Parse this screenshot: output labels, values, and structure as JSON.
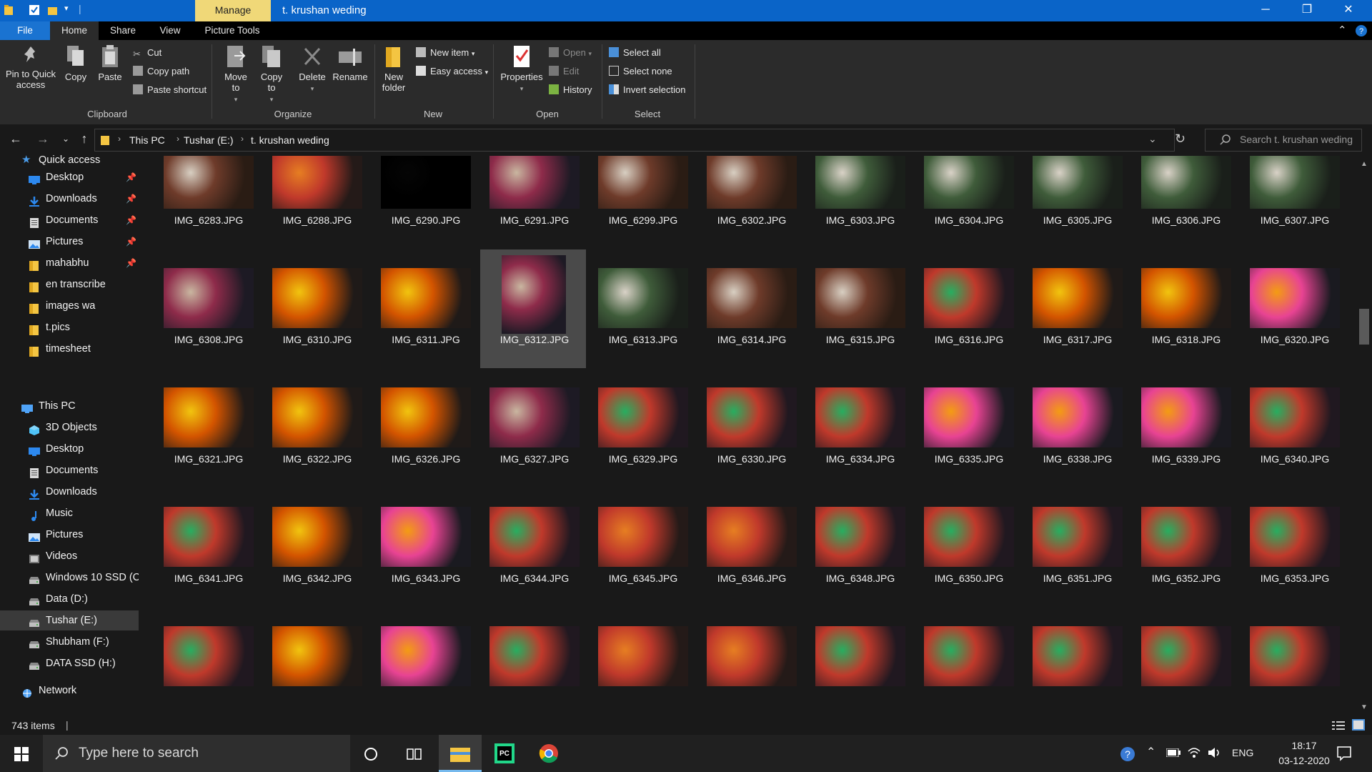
{
  "titlebar": {
    "context_tab": "Manage",
    "title": "t. krushan weding",
    "accent": "#0a64c8"
  },
  "ribbon_tabs": [
    "File",
    "Home",
    "Share",
    "View",
    "Picture Tools"
  ],
  "ribbon": {
    "clipboard": {
      "pin": "Pin to Quick access",
      "copy": "Copy",
      "paste": "Paste",
      "cut": "Cut",
      "copy_path": "Copy path",
      "paste_shortcut": "Paste shortcut",
      "group": "Clipboard"
    },
    "organize": {
      "move_to": "Move to",
      "copy_to": "Copy to",
      "delete": "Delete",
      "rename": "Rename",
      "group": "Organize"
    },
    "new": {
      "new_folder": "New folder",
      "new_item": "New item",
      "easy_access": "Easy access",
      "group": "New"
    },
    "open": {
      "properties": "Properties",
      "open": "Open",
      "edit": "Edit",
      "history": "History",
      "group": "Open"
    },
    "select": {
      "select_all": "Select all",
      "select_none": "Select none",
      "invert": "Invert selection",
      "group": "Select"
    }
  },
  "address": {
    "crumbs": [
      "This PC",
      "Tushar (E:)",
      "t. krushan weding"
    ],
    "search_placeholder": "Search t. krushan weding"
  },
  "sidebar": {
    "quick_access": "Quick access",
    "quick_items": [
      {
        "label": "Desktop",
        "icon": "desktop-icon",
        "pinned": true
      },
      {
        "label": "Downloads",
        "icon": "downloads-icon",
        "pinned": true
      },
      {
        "label": "Documents",
        "icon": "documents-icon",
        "pinned": true
      },
      {
        "label": "Pictures",
        "icon": "pictures-icon",
        "pinned": true
      },
      {
        "label": "mahabhu",
        "icon": "folder-icon",
        "pinned": true
      },
      {
        "label": "en transcribe",
        "icon": "folder-icon",
        "pinned": false
      },
      {
        "label": "images wa",
        "icon": "folder-icon",
        "pinned": false
      },
      {
        "label": "t.pics",
        "icon": "folder-icon",
        "pinned": false
      },
      {
        "label": "timesheet",
        "icon": "folder-icon",
        "pinned": false
      }
    ],
    "this_pc": "This PC",
    "pc_items": [
      {
        "label": "3D Objects",
        "icon": "3d-objects-icon"
      },
      {
        "label": "Desktop",
        "icon": "desktop-icon"
      },
      {
        "label": "Documents",
        "icon": "documents-icon"
      },
      {
        "label": "Downloads",
        "icon": "downloads-icon"
      },
      {
        "label": "Music",
        "icon": "music-icon"
      },
      {
        "label": "Pictures",
        "icon": "pictures-icon"
      },
      {
        "label": "Videos",
        "icon": "videos-icon"
      },
      {
        "label": "Windows 10 SSD (C",
        "icon": "drive-icon"
      },
      {
        "label": "Data (D:)",
        "icon": "drive-icon"
      },
      {
        "label": "Tushar (E:)",
        "icon": "drive-icon",
        "selected": true
      },
      {
        "label": "Shubham (F:)",
        "icon": "drive-icon"
      },
      {
        "label": "DATA SSD (H:)",
        "icon": "drive-icon"
      }
    ],
    "network": "Network"
  },
  "files": [
    "IMG_6283.JPG",
    "IMG_6288.JPG",
    "IMG_6290.JPG",
    "IMG_6291.JPG",
    "IMG_6299.JPG",
    "IMG_6302.JPG",
    "IMG_6303.JPG",
    "IMG_6304.JPG",
    "IMG_6305.JPG",
    "IMG_6306.JPG",
    "IMG_6307.JPG",
    "IMG_6308.JPG",
    "IMG_6310.JPG",
    "IMG_6311.JPG",
    "IMG_6312.JPG",
    "IMG_6313.JPG",
    "IMG_6314.JPG",
    "IMG_6315.JPG",
    "IMG_6316.JPG",
    "IMG_6317.JPG",
    "IMG_6318.JPG",
    "IMG_6320.JPG",
    "IMG_6321.JPG",
    "IMG_6322.JPG",
    "IMG_6326.JPG",
    "IMG_6327.JPG",
    "IMG_6329.JPG",
    "IMG_6330.JPG",
    "IMG_6334.JPG",
    "IMG_6335.JPG",
    "IMG_6338.JPG",
    "IMG_6339.JPG",
    "IMG_6340.JPG",
    "IMG_6341.JPG",
    "IMG_6342.JPG",
    "IMG_6343.JPG",
    "IMG_6344.JPG",
    "IMG_6345.JPG",
    "IMG_6346.JPG",
    "IMG_6348.JPG",
    "IMG_6350.JPG",
    "IMG_6351.JPG",
    "IMG_6352.JPG",
    "IMG_6353.JPG",
    "",
    "",
    "",
    "",
    "",
    "",
    "",
    "",
    "",
    "",
    ""
  ],
  "selected_file": "IMG_6312.JPG",
  "status": {
    "count": "743 items"
  },
  "taskbar": {
    "search_placeholder": "Type here to search",
    "language": "ENG",
    "time": "18:17",
    "date": "03-12-2020"
  }
}
